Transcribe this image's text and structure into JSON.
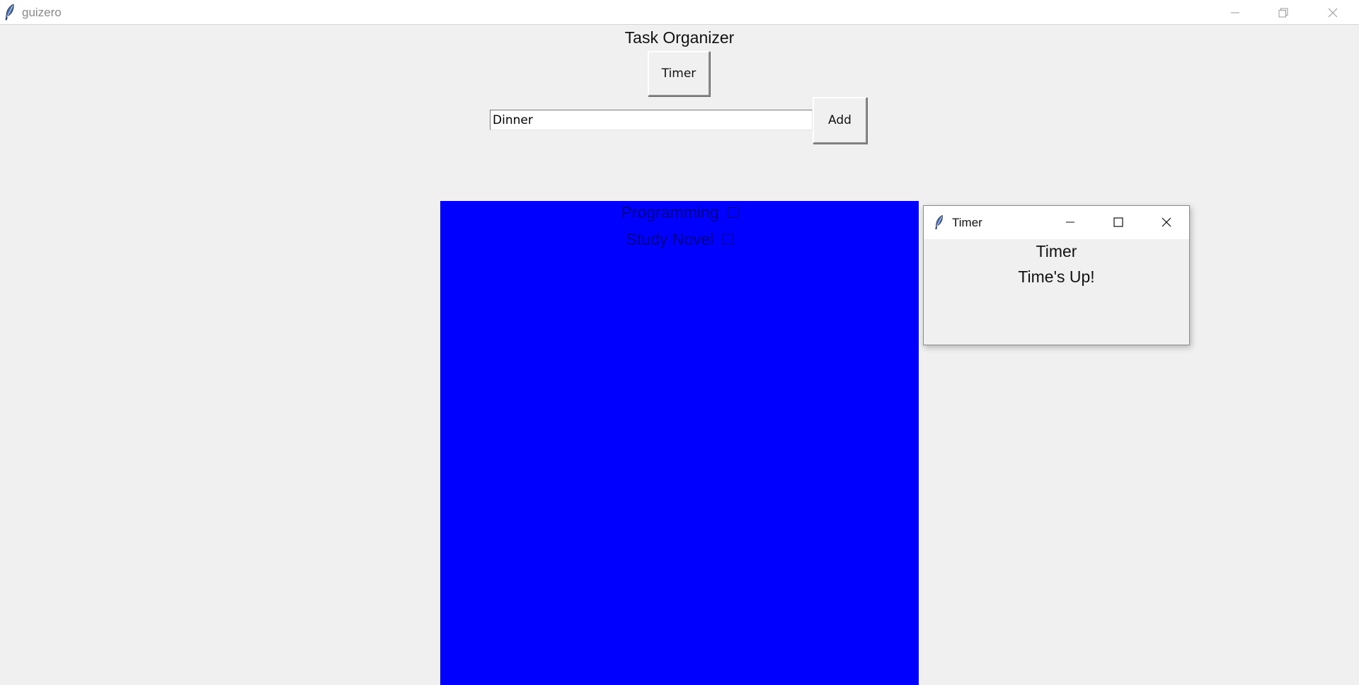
{
  "window": {
    "title": "guizero",
    "icon": "feather-icon",
    "controls": [
      "minimize-icon",
      "restore-icon",
      "close-icon"
    ]
  },
  "main": {
    "title": "Task Organizer",
    "timer_button_label": "Timer",
    "task_input_value": "Dinner",
    "add_button_label": "Add",
    "task_list_bg": "#0000ff",
    "tasks": [
      {
        "label": "Programming",
        "checked": false
      },
      {
        "label": "Study Novel",
        "checked": false
      }
    ]
  },
  "timer_popup": {
    "title": "Timer",
    "heading": "Timer",
    "message": "Time's Up!",
    "icon": "feather-icon",
    "controls": [
      "minimize-icon",
      "maximize-icon",
      "close-icon"
    ]
  }
}
